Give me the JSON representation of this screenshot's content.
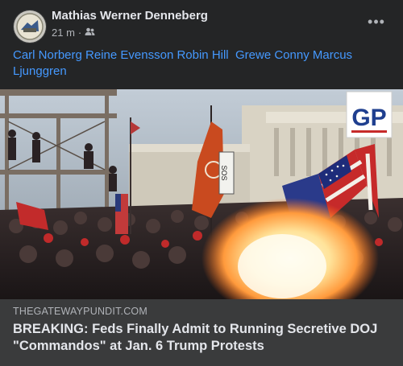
{
  "post": {
    "author": "Mathias Werner Denneberg",
    "time": "21 m",
    "audience_separator": "·",
    "audience_icon": "friends-icon",
    "more_icon": "more-horizontal-icon",
    "tags": [
      "Carl Norberg",
      "Reine Evensson",
      "Robin Hill",
      "Grewe Conny Marcus Ljunggren"
    ]
  },
  "photo": {
    "logo_text": "GP",
    "banner_text": "SOS"
  },
  "link": {
    "domain": "THEGATEWAYPUNDIT.COM",
    "headline": "BREAKING: Feds Finally Admit to Running Secretive DOJ \"Commandos\" at Jan. 6 Trump Protests"
  },
  "colors": {
    "background": "#242526",
    "link_box": "#3a3b3c",
    "tag_link": "#4599ff",
    "primary_text": "#e4e6eb",
    "secondary_text": "#b0b3b8"
  }
}
